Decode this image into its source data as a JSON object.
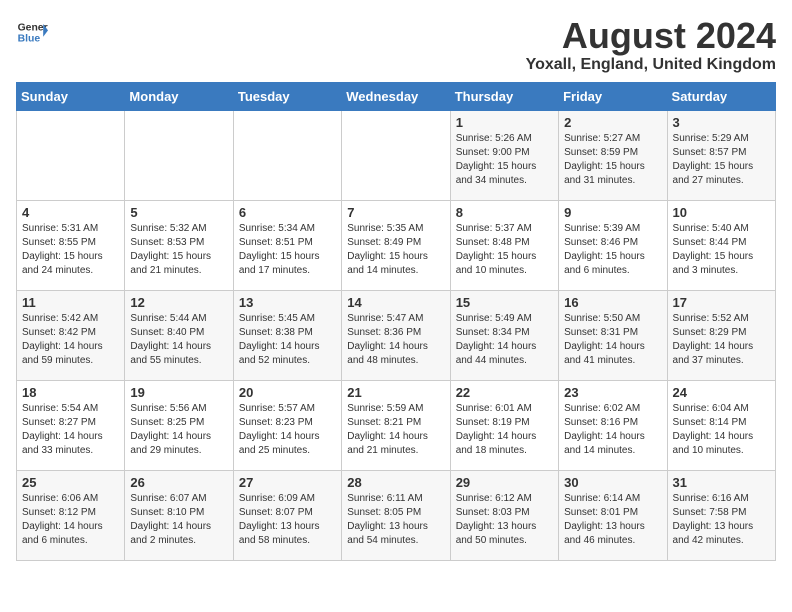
{
  "header": {
    "logo_line1": "General",
    "logo_line2": "Blue",
    "month": "August 2024",
    "location": "Yoxall, England, United Kingdom"
  },
  "days_of_week": [
    "Sunday",
    "Monday",
    "Tuesday",
    "Wednesday",
    "Thursday",
    "Friday",
    "Saturday"
  ],
  "weeks": [
    [
      {
        "day": "",
        "info": ""
      },
      {
        "day": "",
        "info": ""
      },
      {
        "day": "",
        "info": ""
      },
      {
        "day": "",
        "info": ""
      },
      {
        "day": "1",
        "info": "Sunrise: 5:26 AM\nSunset: 9:00 PM\nDaylight: 15 hours\nand 34 minutes."
      },
      {
        "day": "2",
        "info": "Sunrise: 5:27 AM\nSunset: 8:59 PM\nDaylight: 15 hours\nand 31 minutes."
      },
      {
        "day": "3",
        "info": "Sunrise: 5:29 AM\nSunset: 8:57 PM\nDaylight: 15 hours\nand 27 minutes."
      }
    ],
    [
      {
        "day": "4",
        "info": "Sunrise: 5:31 AM\nSunset: 8:55 PM\nDaylight: 15 hours\nand 24 minutes."
      },
      {
        "day": "5",
        "info": "Sunrise: 5:32 AM\nSunset: 8:53 PM\nDaylight: 15 hours\nand 21 minutes."
      },
      {
        "day": "6",
        "info": "Sunrise: 5:34 AM\nSunset: 8:51 PM\nDaylight: 15 hours\nand 17 minutes."
      },
      {
        "day": "7",
        "info": "Sunrise: 5:35 AM\nSunset: 8:49 PM\nDaylight: 15 hours\nand 14 minutes."
      },
      {
        "day": "8",
        "info": "Sunrise: 5:37 AM\nSunset: 8:48 PM\nDaylight: 15 hours\nand 10 minutes."
      },
      {
        "day": "9",
        "info": "Sunrise: 5:39 AM\nSunset: 8:46 PM\nDaylight: 15 hours\nand 6 minutes."
      },
      {
        "day": "10",
        "info": "Sunrise: 5:40 AM\nSunset: 8:44 PM\nDaylight: 15 hours\nand 3 minutes."
      }
    ],
    [
      {
        "day": "11",
        "info": "Sunrise: 5:42 AM\nSunset: 8:42 PM\nDaylight: 14 hours\nand 59 minutes."
      },
      {
        "day": "12",
        "info": "Sunrise: 5:44 AM\nSunset: 8:40 PM\nDaylight: 14 hours\nand 55 minutes."
      },
      {
        "day": "13",
        "info": "Sunrise: 5:45 AM\nSunset: 8:38 PM\nDaylight: 14 hours\nand 52 minutes."
      },
      {
        "day": "14",
        "info": "Sunrise: 5:47 AM\nSunset: 8:36 PM\nDaylight: 14 hours\nand 48 minutes."
      },
      {
        "day": "15",
        "info": "Sunrise: 5:49 AM\nSunset: 8:34 PM\nDaylight: 14 hours\nand 44 minutes."
      },
      {
        "day": "16",
        "info": "Sunrise: 5:50 AM\nSunset: 8:31 PM\nDaylight: 14 hours\nand 41 minutes."
      },
      {
        "day": "17",
        "info": "Sunrise: 5:52 AM\nSunset: 8:29 PM\nDaylight: 14 hours\nand 37 minutes."
      }
    ],
    [
      {
        "day": "18",
        "info": "Sunrise: 5:54 AM\nSunset: 8:27 PM\nDaylight: 14 hours\nand 33 minutes."
      },
      {
        "day": "19",
        "info": "Sunrise: 5:56 AM\nSunset: 8:25 PM\nDaylight: 14 hours\nand 29 minutes."
      },
      {
        "day": "20",
        "info": "Sunrise: 5:57 AM\nSunset: 8:23 PM\nDaylight: 14 hours\nand 25 minutes."
      },
      {
        "day": "21",
        "info": "Sunrise: 5:59 AM\nSunset: 8:21 PM\nDaylight: 14 hours\nand 21 minutes."
      },
      {
        "day": "22",
        "info": "Sunrise: 6:01 AM\nSunset: 8:19 PM\nDaylight: 14 hours\nand 18 minutes."
      },
      {
        "day": "23",
        "info": "Sunrise: 6:02 AM\nSunset: 8:16 PM\nDaylight: 14 hours\nand 14 minutes."
      },
      {
        "day": "24",
        "info": "Sunrise: 6:04 AM\nSunset: 8:14 PM\nDaylight: 14 hours\nand 10 minutes."
      }
    ],
    [
      {
        "day": "25",
        "info": "Sunrise: 6:06 AM\nSunset: 8:12 PM\nDaylight: 14 hours\nand 6 minutes."
      },
      {
        "day": "26",
        "info": "Sunrise: 6:07 AM\nSunset: 8:10 PM\nDaylight: 14 hours\nand 2 minutes."
      },
      {
        "day": "27",
        "info": "Sunrise: 6:09 AM\nSunset: 8:07 PM\nDaylight: 13 hours\nand 58 minutes."
      },
      {
        "day": "28",
        "info": "Sunrise: 6:11 AM\nSunset: 8:05 PM\nDaylight: 13 hours\nand 54 minutes."
      },
      {
        "day": "29",
        "info": "Sunrise: 6:12 AM\nSunset: 8:03 PM\nDaylight: 13 hours\nand 50 minutes."
      },
      {
        "day": "30",
        "info": "Sunrise: 6:14 AM\nSunset: 8:01 PM\nDaylight: 13 hours\nand 46 minutes."
      },
      {
        "day": "31",
        "info": "Sunrise: 6:16 AM\nSunset: 7:58 PM\nDaylight: 13 hours\nand 42 minutes."
      }
    ]
  ]
}
